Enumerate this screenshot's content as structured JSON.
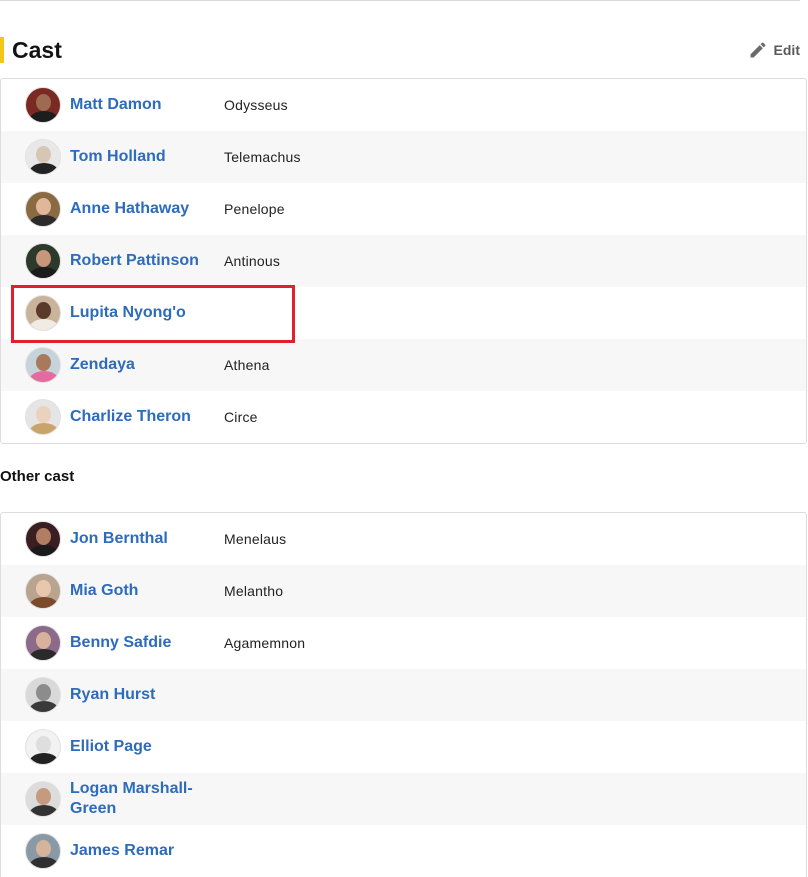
{
  "section": {
    "title": "Cast",
    "edit_label": "Edit"
  },
  "main_cast": [
    {
      "name": "Matt Damon",
      "character": "Odysseus",
      "avatar": {
        "skin": "#9c6b52",
        "bg": "#7a2a22",
        "cloth": "#1d1d1d"
      }
    },
    {
      "name": "Tom Holland",
      "character": "Telemachus",
      "avatar": {
        "skin": "#d8c6b4",
        "bg": "#e8e8e8",
        "cloth": "#222222"
      }
    },
    {
      "name": "Anne Hathaway",
      "character": "Penelope",
      "avatar": {
        "skin": "#e0b79a",
        "bg": "#8a6a43",
        "cloth": "#2b2b2b"
      }
    },
    {
      "name": "Robert Pattinson",
      "character": "Antinous",
      "avatar": {
        "skin": "#c8967b",
        "bg": "#2b3a2a",
        "cloth": "#1b1b1b"
      }
    },
    {
      "name": "Lupita Nyong'o",
      "character": "",
      "avatar": {
        "skin": "#5a3a2b",
        "bg": "#c9b39a",
        "cloth": "#f0ece4"
      }
    },
    {
      "name": "Zendaya",
      "character": "Athena",
      "avatar": {
        "skin": "#a77a5c",
        "bg": "#c7d3da",
        "cloth": "#e46aa0"
      }
    },
    {
      "name": "Charlize Theron",
      "character": "Circe",
      "avatar": {
        "skin": "#ead2bf",
        "bg": "#e5e5e5",
        "cloth": "#c9a46a"
      }
    }
  ],
  "other_cast_heading": "Other cast",
  "other_cast": [
    {
      "name": "Jon Bernthal",
      "character": "Menelaus",
      "avatar": {
        "skin": "#b27e63",
        "bg": "#3a1e22",
        "cloth": "#1a1a1a"
      }
    },
    {
      "name": "Mia Goth",
      "character": "Melantho",
      "avatar": {
        "skin": "#e8c7ad",
        "bg": "#b8a48f",
        "cloth": "#7a4a2a"
      }
    },
    {
      "name": "Benny Safdie",
      "character": "Agamemnon",
      "avatar": {
        "skin": "#d8b29a",
        "bg": "#8b6a8a",
        "cloth": "#2a2a2a"
      }
    },
    {
      "name": "Ryan Hurst",
      "character": "",
      "avatar": {
        "skin": "#8c8c8c",
        "bg": "#d9d9d9",
        "cloth": "#3a3a3a"
      }
    },
    {
      "name": "Elliot Page",
      "character": "",
      "avatar": {
        "skin": "#dedede",
        "bg": "#f2f2f2",
        "cloth": "#222222"
      }
    },
    {
      "name": "Logan Marshall-Green",
      "character": "",
      "avatar": {
        "skin": "#c59a7e",
        "bg": "#dcdcdc",
        "cloth": "#333333"
      }
    },
    {
      "name": "James Remar",
      "character": "",
      "avatar": {
        "skin": "#d6b49c",
        "bg": "#8a99a6",
        "cloth": "#2f2f2f"
      }
    }
  ]
}
